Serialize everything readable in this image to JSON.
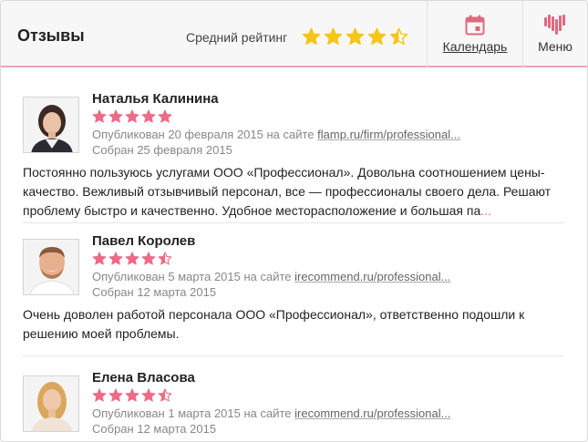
{
  "header": {
    "title": "Отзывы",
    "avg_label": "Средний рейтинг",
    "avg_rating": 4.5,
    "star_color": "#f5c518",
    "calendar_label": "Календарь",
    "menu_label": "Меню",
    "accent_color": "#e0687f"
  },
  "reviews": [
    {
      "name": "Наталья Калинина",
      "rating": 5,
      "published_prefix": "Опубликован 20 февраля 2015 на сайте",
      "published_site": "flamp.ru/firm/professional...",
      "collected": "Собран 25 февраля 2015",
      "text": "Постоянно пользуюсь услугами ООО «Профессионал». Довольна соотношением цены-качество. Вежливый отзывчивый персонал, все — профессионалы своего дела. Решают проблему быстро и качественно. Удобное месторасположение и большая па",
      "more": "...",
      "avatar": "woman-dark-hair-avatar"
    },
    {
      "name": "Павел Королев",
      "rating": 4.5,
      "published_prefix": "Опубликован 5 марта 2015 на сайте",
      "published_site": "irecommend.ru/professional...",
      "collected": "Собран 12 марта 2015",
      "text": "Очень доволен работой персонала ООО «Профессионал», ответственно подошли к решению моей проблемы.",
      "more": "",
      "avatar": "man-smiling-avatar"
    },
    {
      "name": "Елена Власова",
      "rating": 4.5,
      "published_prefix": "Опубликован 1 марта 2015 на сайте",
      "published_site": "irecommend.ru/professional...",
      "collected": "Собран 12 марта 2015",
      "text": "",
      "more": "",
      "avatar": "woman-blonde-avatar"
    }
  ],
  "review_star_color": "#ee6a86"
}
